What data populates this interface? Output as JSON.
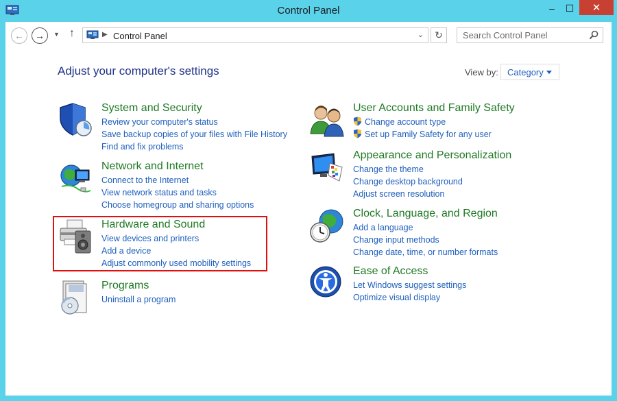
{
  "window": {
    "title": "Control Panel",
    "close_symbol": "✕",
    "max_symbol": "☐",
    "min_symbol": "–"
  },
  "nav": {
    "address": "Control Panel",
    "search_placeholder": "Search Control Panel"
  },
  "main": {
    "heading": "Adjust your computer's settings",
    "view_by_label": "View by:",
    "view_by_value": "Category"
  },
  "categories": {
    "system": {
      "title": "System and Security",
      "icon": "shield-icon",
      "links": [
        "Review your computer's status",
        "Save backup copies of your files with File History",
        "Find and fix problems"
      ]
    },
    "network": {
      "title": "Network and Internet",
      "icon": "network-globe-icon",
      "links": [
        "Connect to the Internet",
        "View network status and tasks",
        "Choose homegroup and sharing options"
      ]
    },
    "hardware": {
      "title": "Hardware and Sound",
      "icon": "printer-speaker-icon",
      "links": [
        "View devices and printers",
        "Add a device",
        "Adjust commonly used mobility settings"
      ]
    },
    "programs": {
      "title": "Programs",
      "icon": "programs-disc-icon",
      "links": [
        "Uninstall a program"
      ]
    },
    "users": {
      "title": "User Accounts and Family Safety",
      "icon": "users-icon",
      "links": [
        "Change account type",
        "Set up Family Safety for any user"
      ]
    },
    "appearance": {
      "title": "Appearance and Personalization",
      "icon": "monitor-palette-icon",
      "links": [
        "Change the theme",
        "Change desktop background",
        "Adjust screen resolution"
      ]
    },
    "clock": {
      "title": "Clock, Language, and Region",
      "icon": "clock-globe-icon",
      "links": [
        "Add a language",
        "Change input methods",
        "Change date, time, or number formats"
      ]
    },
    "ease": {
      "title": "Ease of Access",
      "icon": "ease-of-access-icon",
      "links": [
        "Let Windows suggest settings",
        "Optimize visual display"
      ]
    }
  },
  "colors": {
    "accent_title": "#1e3287",
    "category_green": "#1f7a24",
    "link_blue": "#1e5fbd",
    "frame": "#5ad2ea",
    "close": "#c84031",
    "highlight": "#e01010"
  }
}
